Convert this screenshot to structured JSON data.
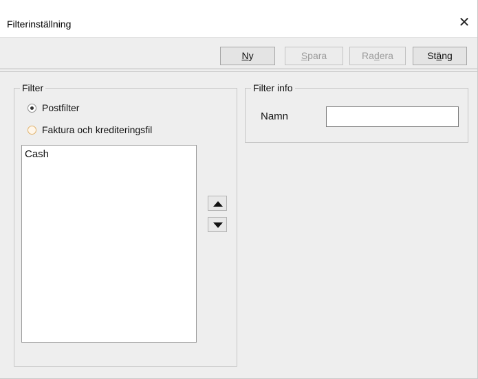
{
  "window": {
    "title": "Filterinställning",
    "close_glyph": "✕"
  },
  "toolbar": {
    "ny": {
      "pre": "",
      "accel": "N",
      "post": "y"
    },
    "spara": {
      "pre": "",
      "accel": "S",
      "post": "para"
    },
    "radera": {
      "pre": "Ra",
      "accel": "d",
      "post": "era"
    },
    "stang": {
      "pre": "St",
      "accel": "ä",
      "post": "ng"
    }
  },
  "filter_group": {
    "legend": "Filter",
    "options": [
      {
        "label": "Postfilter",
        "checked": true
      },
      {
        "label": "Faktura och krediteringsfil",
        "checked": false
      }
    ],
    "list_items": [
      "Cash"
    ],
    "move_up_icon": "triangle-up",
    "move_down_icon": "triangle-down"
  },
  "filter_info": {
    "legend": "Filter info",
    "name_label": "Namn",
    "name_value": ""
  }
}
